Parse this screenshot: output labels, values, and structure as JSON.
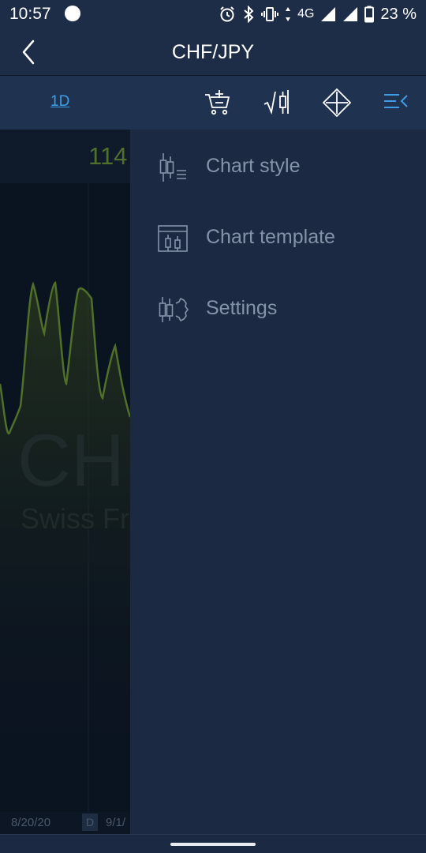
{
  "status_bar": {
    "time": "10:57",
    "network": "4G",
    "battery": "23 %"
  },
  "app_bar": {
    "title": "CHF/JPY",
    "back_icon": "chevron-left-icon"
  },
  "toolbar": {
    "timeframe": "1D",
    "icons": [
      "cart-add-icon",
      "indicator-icon",
      "move-arrows-icon",
      "menu-collapse-icon"
    ],
    "accent_color": "#3d9ee6"
  },
  "chart": {
    "price_label": "114",
    "watermark_symbol": "CH",
    "watermark_name": "Swiss Fr",
    "dates": [
      "8/20/20",
      "D",
      "9/1/"
    ],
    "line_color": "#4f6f2a"
  },
  "drawer": {
    "items": [
      {
        "label": "Chart style",
        "icon": "chart-style-icon"
      },
      {
        "label": "Chart template",
        "icon": "chart-template-icon"
      },
      {
        "label": "Settings",
        "icon": "chart-settings-icon"
      }
    ]
  }
}
